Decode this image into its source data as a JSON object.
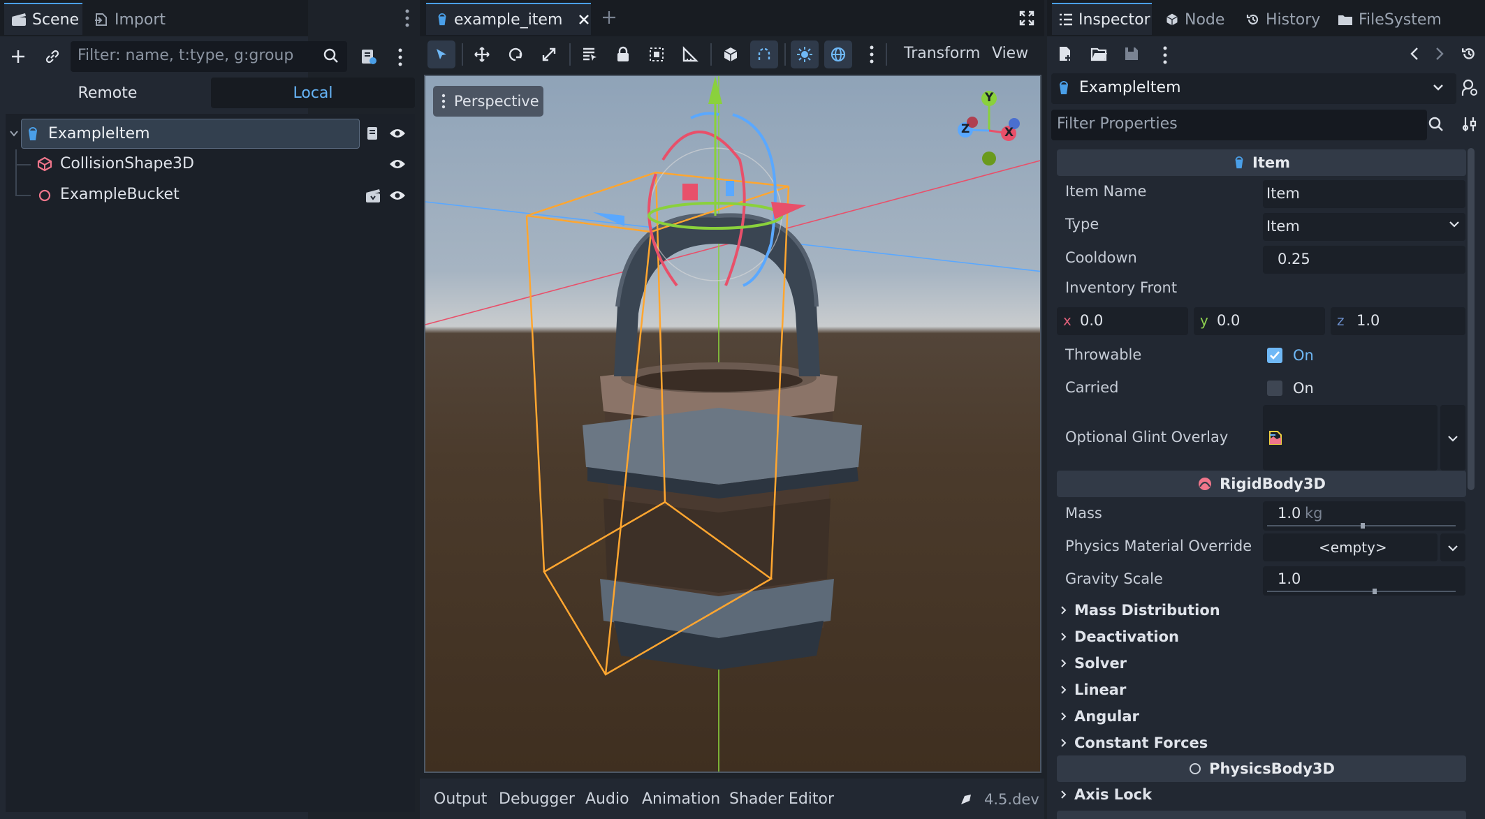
{
  "left_dock": {
    "tabs": [
      {
        "label": "Scene"
      },
      {
        "label": "Import"
      }
    ],
    "filter_placeholder": "Filter: name, t:type, g:group",
    "remote_label": "Remote",
    "local_label": "Local",
    "tree": [
      {
        "label": "ExampleItem"
      },
      {
        "label": "CollisionShape3D"
      },
      {
        "label": "ExampleBucket"
      }
    ]
  },
  "editor": {
    "tab_label": "example_item",
    "transform_menu": "Transform",
    "view_menu": "View",
    "perspective_label": "Perspective",
    "gizmo": {
      "x": "X",
      "y": "Y",
      "z": "Z"
    }
  },
  "bottom_bar": {
    "tabs": [
      "Output",
      "Debugger",
      "Audio",
      "Animation",
      "Shader Editor"
    ],
    "version": "4.5.dev"
  },
  "inspector": {
    "tabs": [
      {
        "label": "Inspector"
      },
      {
        "label": "Node"
      },
      {
        "label": "History"
      },
      {
        "label": "FileSystem"
      }
    ],
    "node_name": "ExampleItem",
    "filter_placeholder": "Filter Properties",
    "item_section": "Item",
    "item_name_label": "Item Name",
    "item_name_value": "Item",
    "type_label": "Type",
    "type_value": "Item",
    "cooldown_label": "Cooldown",
    "cooldown_value": "0.25",
    "inventory_front_label": "Inventory Front",
    "inv_x_label": "x",
    "inv_x": "0.0",
    "inv_y_label": "y",
    "inv_y": "0.0",
    "inv_z_label": "z",
    "inv_z": "1.0",
    "throwable_label": "Throwable",
    "throwable_value": "On",
    "throwable_checked": true,
    "carried_label": "Carried",
    "carried_value": "On",
    "carried_checked": false,
    "glint_label": "Optional Glint Overlay",
    "rigidbody_section": "RigidBody3D",
    "mass_label": "Mass",
    "mass_value": "1.0",
    "mass_unit": "kg",
    "physmat_label": "Physics Material Override",
    "physmat_value": "<empty>",
    "gravity_label": "Gravity Scale",
    "gravity_value": "1.0",
    "groups": [
      "Mass Distribution",
      "Deactivation",
      "Solver",
      "Linear",
      "Angular",
      "Constant Forces"
    ],
    "physicsbody_section": "PhysicsBody3D",
    "axis_lock": "Axis Lock"
  }
}
